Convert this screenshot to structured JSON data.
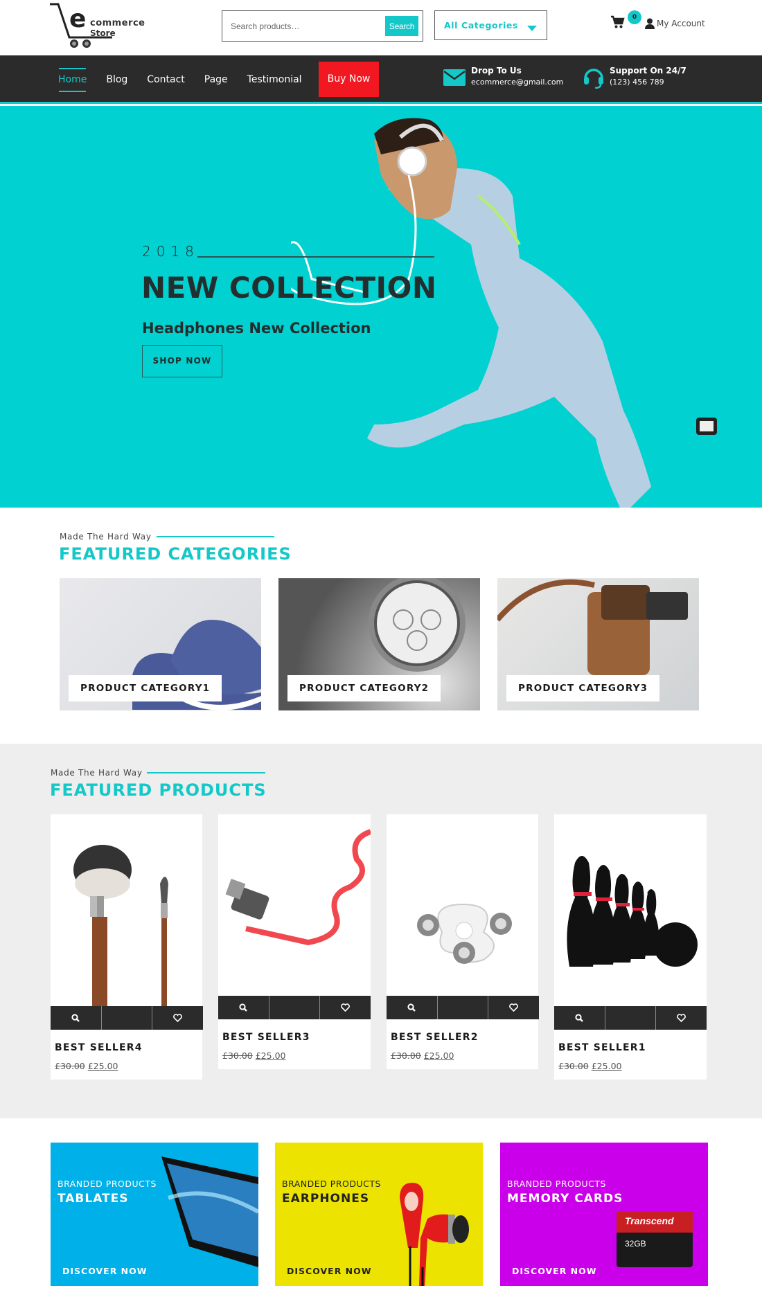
{
  "header": {
    "logo": {
      "big_letter": "e",
      "line1": "commerce",
      "line2": "Store"
    },
    "search": {
      "placeholder": "Search products…",
      "button_label": "Search"
    },
    "category_select": {
      "selected": "All Categories"
    },
    "cart": {
      "count": "0"
    },
    "account_label": "My Account"
  },
  "nav": {
    "items": [
      {
        "label": "Home",
        "active": true
      },
      {
        "label": "Blog"
      },
      {
        "label": "Contact"
      },
      {
        "label": "Page"
      },
      {
        "label": "Testimonial"
      }
    ],
    "buy_now": "Buy Now",
    "email": {
      "title": "Drop To Us",
      "value": "ecommerce@gmail.com"
    },
    "support": {
      "title": "Support On 24/7",
      "value": "(123) 456 789"
    }
  },
  "hero": {
    "year": "2018",
    "title": "NEW COLLECTION",
    "subtitle": "Headphones New Collection",
    "button": "SHOP NOW"
  },
  "featured_categories": {
    "kicker": "Made The Hard Way",
    "title": "FEATURED CATEGORIES",
    "items": [
      {
        "label": "PRODUCT CATEGORY1"
      },
      {
        "label": "PRODUCT CATEGORY2"
      },
      {
        "label": "PRODUCT CATEGORY3"
      }
    ]
  },
  "featured_products": {
    "kicker": "Made The Hard Way",
    "title": "FEATURED PRODUCTS",
    "items": [
      {
        "name": "BEST SELLER4",
        "old_price": "£30.00",
        "price": "£25.00"
      },
      {
        "name": "BEST SELLER3",
        "old_price": "£30.00",
        "price": "£25.00"
      },
      {
        "name": "BEST SELLER2",
        "old_price": "£30.00",
        "price": "£25.00"
      },
      {
        "name": "BEST SELLER1",
        "old_price": "£30.00",
        "price": "£25.00"
      }
    ]
  },
  "banners": [
    {
      "kicker": "BRANDED PRODUCTS",
      "title": "TABLATES",
      "cta": "DISCOVER NOW",
      "bg": "#00b0e8"
    },
    {
      "kicker": "BRANDED PRODUCTS",
      "title": "EARPHONES",
      "cta": "DISCOVER NOW",
      "bg": "#ece400"
    },
    {
      "kicker": "BRANDED PRODUCTS",
      "title": "MEMORY CARDS",
      "cta": "DISCOVER NOW",
      "bg": "#cb00ea"
    }
  ],
  "colors": {
    "accent": "#14c8c9",
    "nav_bg": "#2b2b2b",
    "buy_now": "#f21821",
    "hero_bg": "#02d1d1"
  }
}
